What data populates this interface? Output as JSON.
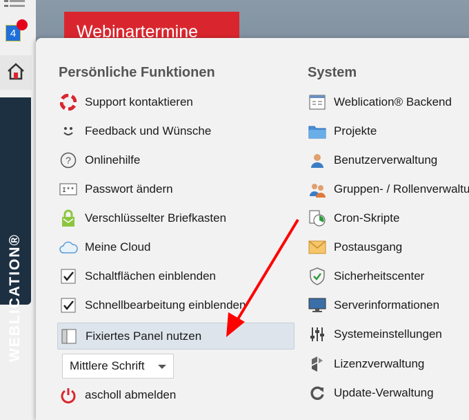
{
  "header": {
    "button_label": "Webinartermine"
  },
  "notifications": {
    "count": "4"
  },
  "branding": {
    "brand_text": "WEBLICATION®"
  },
  "personal": {
    "title": "Persönliche Funktionen",
    "items": [
      {
        "label": "Support kontaktieren",
        "icon": "lifebuoy-icon"
      },
      {
        "label": "Feedback und Wünsche",
        "icon": "smiley-icon"
      },
      {
        "label": "Onlinehilfe",
        "icon": "help-icon"
      },
      {
        "label": "Passwort ändern",
        "icon": "password-icon"
      },
      {
        "label": "Verschlüsselter Briefkasten",
        "icon": "lock-mailbox-icon"
      },
      {
        "label": "Meine Cloud",
        "icon": "cloud-icon"
      },
      {
        "label": "Schaltflächen einblenden",
        "icon": "checkbox-checked-icon",
        "checked": true
      },
      {
        "label": "Schnellbearbeitung einblenden",
        "icon": "checkbox-checked-icon",
        "checked": true
      },
      {
        "label": "Fixiertes Panel nutzen",
        "icon": "panel-icon",
        "active": true
      }
    ],
    "font_select": {
      "value": "Mittlere Schrift"
    },
    "logout": {
      "label": "ascholl abmelden",
      "icon": "power-icon"
    }
  },
  "system": {
    "title": "System",
    "items": [
      {
        "label": "Weblication® Backend",
        "icon": "backend-window-icon"
      },
      {
        "label": "Projekte",
        "icon": "folder-icon"
      },
      {
        "label": "Benutzerverwaltung",
        "icon": "user-icon"
      },
      {
        "label": "Gruppen- / Rollenverwaltung",
        "icon": "group-icon"
      },
      {
        "label": "Cron-Skripte",
        "icon": "cron-icon"
      },
      {
        "label": "Postausgang",
        "icon": "envelope-icon"
      },
      {
        "label": "Sicherheitscenter",
        "icon": "shield-check-icon"
      },
      {
        "label": "Serverinformationen",
        "icon": "monitor-icon"
      },
      {
        "label": "Systemeinstellungen",
        "icon": "sliders-icon"
      },
      {
        "label": "Lizenzverwaltung",
        "icon": "license-icon"
      },
      {
        "label": "Update-Verwaltung",
        "icon": "update-icon"
      }
    ]
  },
  "colors": {
    "accent_red": "#d9262e",
    "brand_dark": "#1d3042",
    "arrow_red": "#ff0000"
  }
}
